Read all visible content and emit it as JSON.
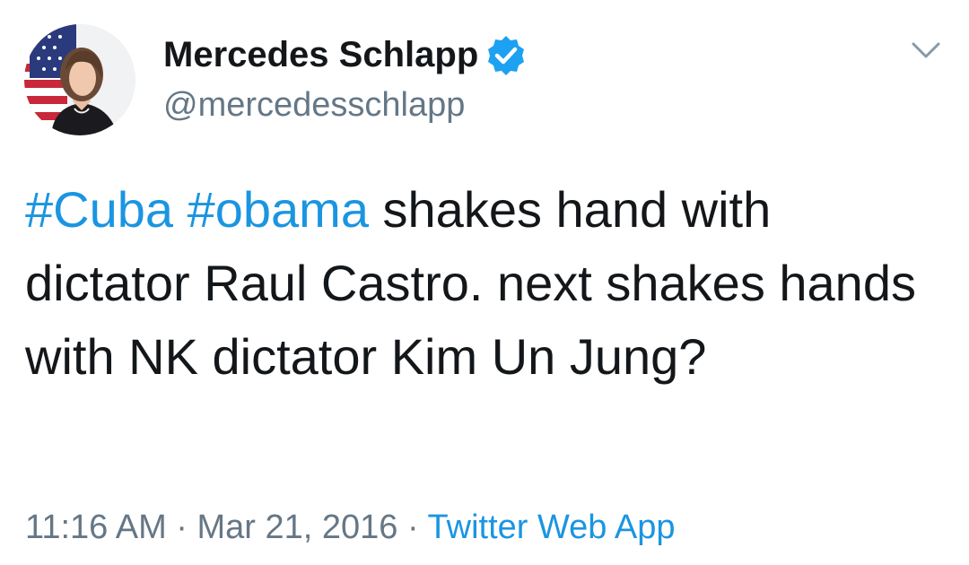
{
  "author": {
    "display_name": "Mercedes Schlapp",
    "handle": "@mercedesschlapp",
    "verified": true,
    "avatar_icon": "profile-photo"
  },
  "tweet": {
    "hashtags": [
      "#Cuba",
      "#obama"
    ],
    "text_line1_rest": "shakes hand with",
    "text_rest": "dictator Raul Castro.  next shakes hands with NK dictator Kim Un Jung?"
  },
  "meta": {
    "time": "11:16 AM",
    "separator": "·",
    "date": "Mar 21, 2016",
    "source": "Twitter Web App"
  },
  "colors": {
    "link": "#1b95e0",
    "verified": "#1da1f2",
    "secondary_text": "#657786",
    "primary_text": "#14171a"
  },
  "icons": {
    "verified": "verified-badge-icon",
    "menu": "chevron-down-icon"
  }
}
